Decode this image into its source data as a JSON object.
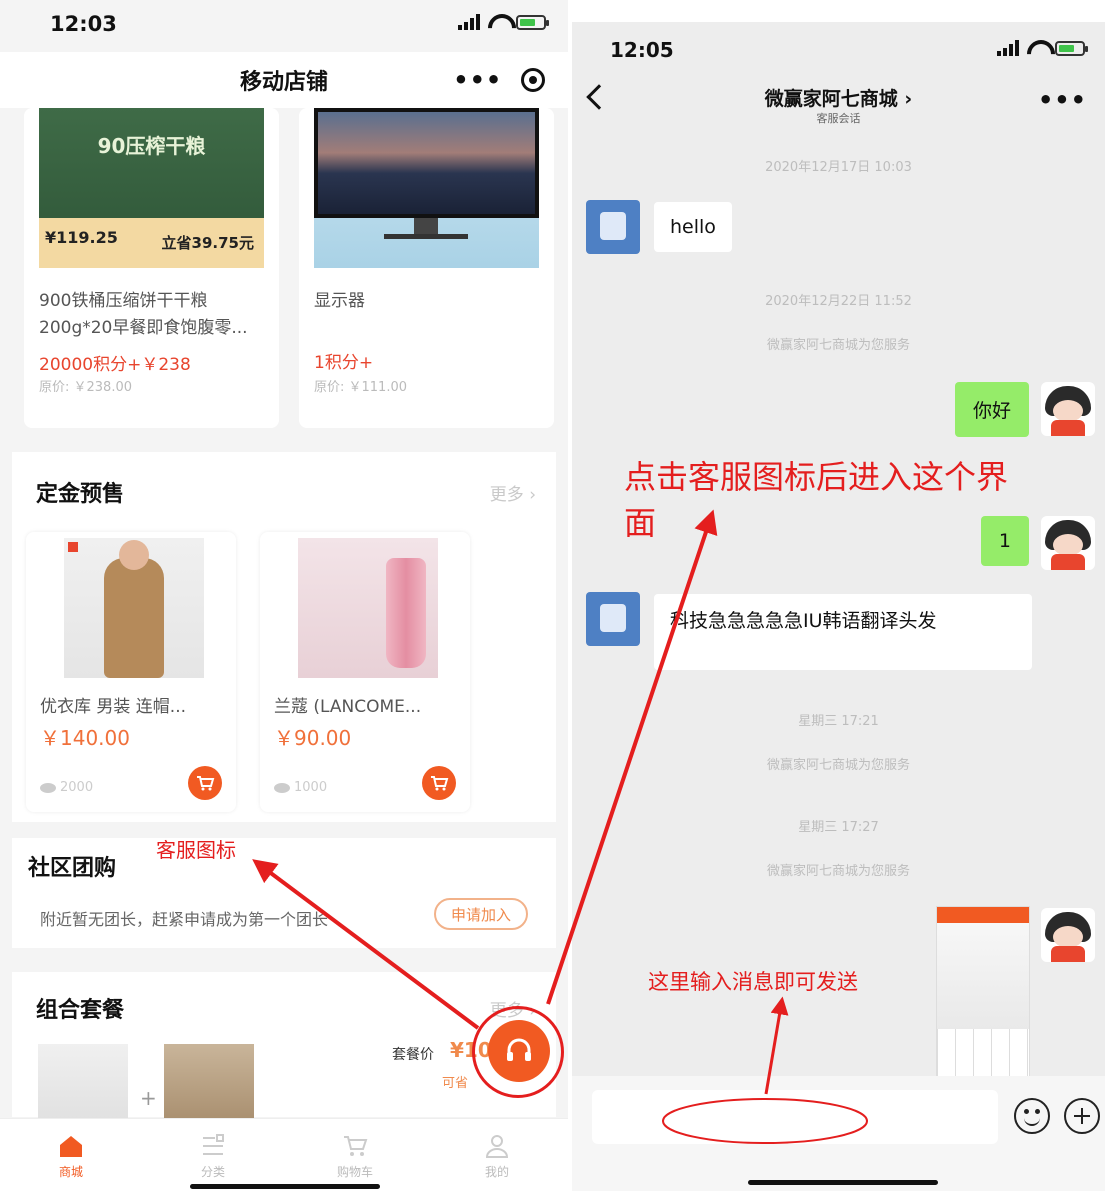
{
  "left_phone": {
    "status": {
      "time": "12:03"
    },
    "nav": {
      "title": "移动店铺"
    },
    "products": [
      {
        "image_heading": "90压榨干粮",
        "image_price": "¥119.25",
        "image_saving": "立省39.75元",
        "name": "900铁桶压缩饼干干粮200g*20早餐即食饱腹零...",
        "price": "20000积分+￥238",
        "original": "原价: ￥238.00"
      },
      {
        "name": "显示器",
        "price": "1积分+",
        "original": "原价: ￥111.00"
      }
    ],
    "deposit": {
      "title": "定金预售",
      "more": "更多 ›",
      "items": [
        {
          "name": "优衣库 男装 连帽...",
          "price": "￥140.00",
          "views": "2000"
        },
        {
          "name": "兰蔻 (LANCOME...",
          "price": "￥90.00",
          "views": "1000"
        }
      ]
    },
    "group_buy": {
      "title": "社区团购",
      "desc": "附近暂无团长，赶紧申请成为第一个团长",
      "apply": "申请加入"
    },
    "bundle": {
      "title": "组合套餐",
      "more": "更多 ›",
      "pkg_label": "套餐价",
      "pkg_price": "¥10",
      "available": "可省"
    },
    "tabs": [
      {
        "label": "商城",
        "icon": "home-icon"
      },
      {
        "label": "分类",
        "icon": "category-icon"
      },
      {
        "label": "购物车",
        "icon": "cart-icon"
      },
      {
        "label": "我的",
        "icon": "user-icon"
      }
    ]
  },
  "right_phone": {
    "status": {
      "time": "12:05"
    },
    "nav": {
      "title": "微赢家阿七商城 ›",
      "subtitle": "客服会话"
    },
    "messages": [
      {
        "ts": "2020年12月17日 10:03"
      },
      {
        "from": "bot",
        "text": "hello"
      },
      {
        "ts": "2020年12月22日 11:52"
      },
      {
        "notice": "微赢家阿七商城为您服务"
      },
      {
        "from": "user",
        "text": "你好"
      },
      {
        "from": "user",
        "text": "1"
      },
      {
        "from": "bot",
        "text": "科技急急急急急IU韩语翻译头发"
      },
      {
        "ts": "星期三 17:21"
      },
      {
        "notice": "微赢家阿七商城为您服务"
      },
      {
        "ts": "星期三 17:27"
      },
      {
        "notice": "微赢家阿七商城为您服务"
      }
    ]
  },
  "annotations": {
    "cs_icon": "客服图标",
    "enter": "点击客服图标后进入这个界面",
    "enter_l1": "点击客服图标后进入这个界",
    "enter_l2": "面",
    "input_hint": "这里输入消息即可发送"
  },
  "colors": {
    "accent": "#f15a22",
    "annotation": "#e41e1e",
    "bubble_user": "#95ec69"
  }
}
